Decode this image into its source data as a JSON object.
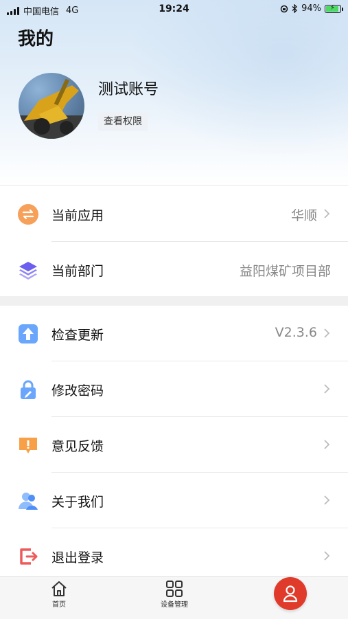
{
  "status_bar": {
    "carrier": "中国电信",
    "network": "4G",
    "time": "19:24",
    "battery": "94%",
    "battery_level": 0.94
  },
  "page": {
    "title": "我的"
  },
  "profile": {
    "username": "测试账号",
    "permission_button": "查看权限"
  },
  "menu_group_1": [
    {
      "label": "当前应用",
      "value": "华顺",
      "icon": "switch-icon",
      "color": "#f6a05a"
    },
    {
      "label": "当前部门",
      "value": "益阳煤矿项目部",
      "icon": "layers-icon",
      "color": "#7a6df2"
    }
  ],
  "menu_group_2": [
    {
      "label": "检查更新",
      "value": "V2.3.6",
      "icon": "upload-icon",
      "color": "#4f8ff7"
    },
    {
      "label": "修改密码",
      "value": "",
      "icon": "lock-icon",
      "color": "#4f8ff7"
    },
    {
      "label": "意见反馈",
      "value": "",
      "icon": "feedback-icon",
      "color": "#f59a33"
    },
    {
      "label": "关于我们",
      "value": "",
      "icon": "users-icon",
      "color": "#5a9cf5"
    },
    {
      "label": "退出登录",
      "value": "",
      "icon": "logout-icon",
      "color": "#ee5a5a"
    }
  ],
  "tabbar": {
    "items": [
      {
        "label": "首页",
        "icon": "home-icon"
      },
      {
        "label": "设备管理",
        "icon": "grid-icon"
      },
      {
        "label": "",
        "icon": "user-icon",
        "active": true,
        "color": "#e03a2a"
      }
    ]
  }
}
